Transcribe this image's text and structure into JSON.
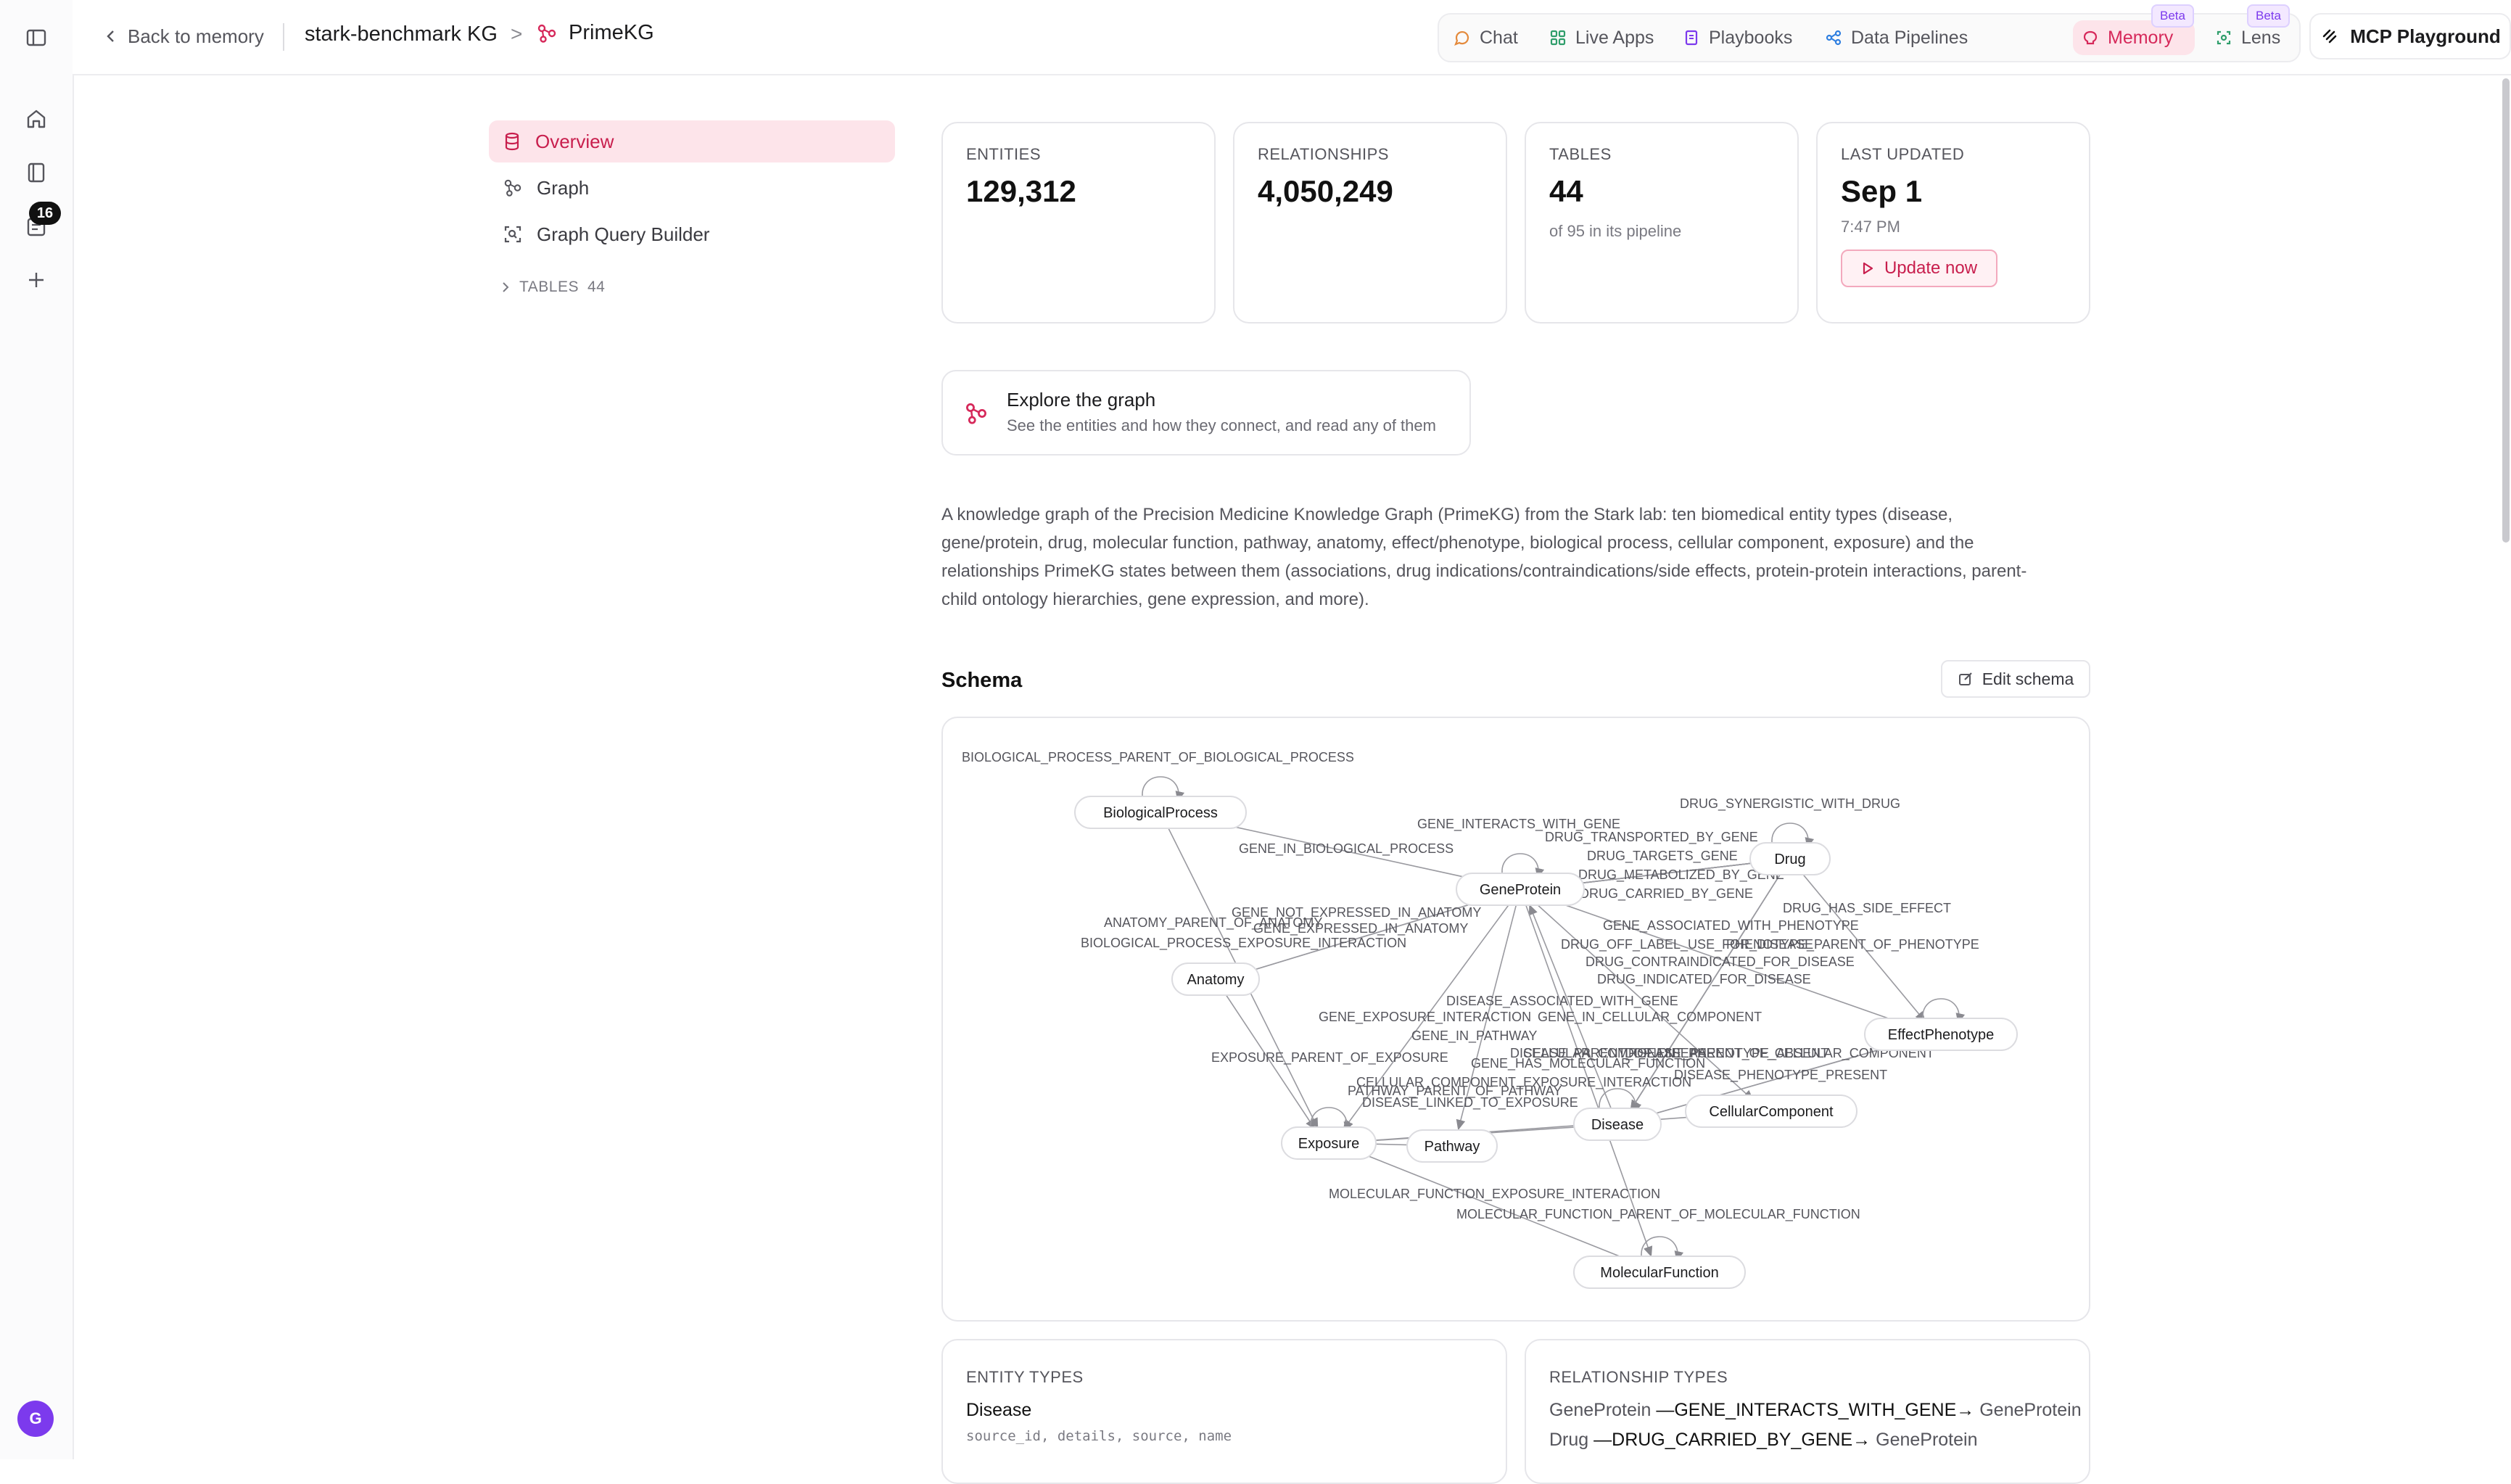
{
  "rail": {
    "badge": "16",
    "avatar": "G"
  },
  "topbar": {
    "back_label": "Back to memory",
    "crumb_kg": "stark-benchmark KG",
    "crumb_sep": ">",
    "crumb_current": "PrimeKG",
    "nav": [
      {
        "label": "Chat"
      },
      {
        "label": "Live Apps"
      },
      {
        "label": "Playbooks"
      },
      {
        "label": "Data Pipelines"
      },
      {
        "label": "Memory",
        "badge": "Beta"
      },
      {
        "label": "Lens",
        "badge": "Beta"
      }
    ],
    "mcp_label": "MCP Playground"
  },
  "sidenav": {
    "items": [
      {
        "label": "Overview"
      },
      {
        "label": "Graph"
      },
      {
        "label": "Graph Query Builder"
      }
    ],
    "tables_label": "TABLES",
    "tables_count": "44"
  },
  "stats": [
    {
      "label": "ENTITIES",
      "value": "129,312"
    },
    {
      "label": "RELATIONSHIPS",
      "value": "4,050,249"
    },
    {
      "label": "TABLES",
      "value": "44",
      "sub": "of 95 in its pipeline"
    },
    {
      "label": "LAST UPDATED",
      "value": "Sep 1",
      "sub": "7:47 PM",
      "button": "Update now"
    }
  ],
  "explore": {
    "title": "Explore the graph",
    "subtitle": "See the entities and how they connect, and read any of them"
  },
  "description": "A knowledge graph of the Precision Medicine Knowledge Graph (PrimeKG) from the Stark lab: ten biomedical entity types (disease, gene/protein, drug, molecular function, pathway, anatomy, effect/phenotype, biological process, cellular component, exposure) and the relationships PrimeKG states between them (associations, drug indications/contraindications/side effects, protein-protein interactions, parent-child ontology hierarchies, gene expression, and more).",
  "schema": {
    "title": "Schema",
    "edit_label": "Edit schema",
    "nodes": [
      {
        "id": "BiologicalProcess",
        "label": "BiologicalProcess"
      },
      {
        "id": "GeneProtein",
        "label": "GeneProtein"
      },
      {
        "id": "Drug",
        "label": "Drug"
      },
      {
        "id": "Anatomy",
        "label": "Anatomy"
      },
      {
        "id": "EffectPhenotype",
        "label": "EffectPhenotype"
      },
      {
        "id": "CellularComponent",
        "label": "CellularComponent"
      },
      {
        "id": "Disease",
        "label": "Disease"
      },
      {
        "id": "Exposure",
        "label": "Exposure"
      },
      {
        "id": "Pathway",
        "label": "Pathway"
      },
      {
        "id": "MolecularFunction",
        "label": "MolecularFunction"
      }
    ],
    "edge_labels": [
      "BIOLOGICAL_PROCESS_PARENT_OF_BIOLOGICAL_PROCESS",
      "DRUG_SYNERGISTIC_WITH_DRUG",
      "GENE_INTERACTS_WITH_GENE",
      "DRUG_TRANSPORTED_BY_GENE",
      "GENE_IN_BIOLOGICAL_PROCESS",
      "DRUG_TARGETS_GENE",
      "DRUG_METABOLIZED_BY_GENE",
      "DRUG_CARRIED_BY_GENE",
      "GENE_NOT_EXPRESSED_IN_ANATOMY",
      "DRUG_HAS_SIDE_EFFECT",
      "ANATOMY_PARENT_OF_ANATOMY",
      "GENE_EXPRESSED_IN_ANATOMY",
      "GENE_ASSOCIATED_WITH_PHENOTYPE",
      "BIOLOGICAL_PROCESS_EXPOSURE_INTERACTION",
      "DRUG_OFF_LABEL_USE_FOR_DISEASE",
      "PHENOTYPE_PARENT_OF_PHENOTYPE",
      "DRUG_CONTRAINDICATED_FOR_DISEASE",
      "DRUG_INDICATED_FOR_DISEASE",
      "DISEASE_ASSOCIATED_WITH_GENE",
      "GENE_EXPOSURE_INTERACTION",
      "GENE_IN_CELLULAR_COMPONENT",
      "GENE_IN_PATHWAY",
      "EXPOSURE_PARENT_OF_EXPOSURE",
      "GENE_HAS_MOLECULAR_FUNCTION",
      "DISEASE_PHENOTYPE_ABSENT",
      "CELLULAR_COMPONENT_PARENT_OF_CELLULAR_COMPONENT",
      "CELLULAR_COMPONENT_EXPOSURE_INTERACTION",
      "DISEASE_PHENOTYPE_PRESENT",
      "PATHWAY_PARENT_OF_PATHWAY",
      "DISEASE_LINKED_TO_EXPOSURE",
      "MOLECULAR_FUNCTION_EXPOSURE_INTERACTION",
      "MOLECULAR_FUNCTION_PARENT_OF_MOLECULAR_FUNCTION",
      "DISEASE_PARENT_OF_DISEASE"
    ]
  },
  "entity_types": {
    "label": "ENTITY TYPES",
    "first_name": "Disease",
    "first_fields": "source_id, details, source, name"
  },
  "relationship_types": {
    "label": "RELATIONSHIP TYPES",
    "rows": [
      {
        "from": "GeneProtein",
        "rel": "—GENE_INTERACTS_WITH_GENE→",
        "to": "GeneProtein"
      },
      {
        "from": "Drug",
        "rel": "—DRUG_CARRIED_BY_GENE→",
        "to": "GeneProtein"
      }
    ]
  },
  "colors": {
    "accent": "#d6285a",
    "accent_bg": "#fde4ea",
    "beta": "#7c3aed"
  },
  "icons": [
    "sidebar-toggle-icon",
    "home-icon",
    "book-icon",
    "inbox-icon",
    "plus-icon",
    "chevron-left-icon",
    "graph-icon",
    "chat-icon",
    "apps-icon",
    "playbook-icon",
    "pipeline-icon",
    "memory-icon",
    "lens-icon",
    "mcp-icon",
    "gear-icon",
    "database-icon",
    "query-icon",
    "chevron-right-icon",
    "play-icon",
    "edit-icon"
  ]
}
